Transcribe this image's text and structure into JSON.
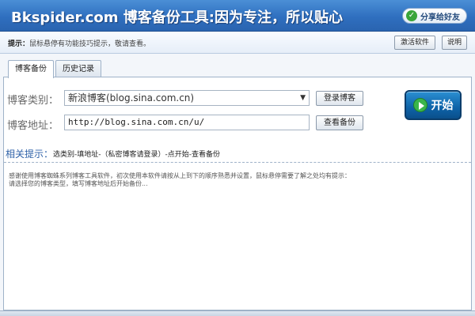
{
  "window": {
    "title": "Bkspider.com 博客备份工具:因为专注，所以贴心"
  },
  "header": {
    "share_label": "分享给好友",
    "share_icon": "share-icon"
  },
  "infobar": {
    "label": "提示：",
    "text": "鼠标悬停有功能技巧提示，敬请查看。",
    "register_label": "激活软件",
    "help_label": "说明"
  },
  "tabs": [
    {
      "label": "博客备份",
      "active": true
    },
    {
      "label": "历史记录",
      "active": false
    }
  ],
  "form": {
    "type_label": "博客类别：",
    "type_value": "新浪博客(blog.sina.com.cn)",
    "login_button": "登录博客",
    "address_label": "博客地址：",
    "address_value": "http://blog.sina.com.cn/u/",
    "view_button": "查看备份",
    "start_button": "开始"
  },
  "hint": {
    "title": "相关提示：",
    "text": "选类别-填地址-（私密博客请登录）-点开始-查看备份"
  },
  "content": {
    "lines": [
      "感谢使用博客蜘蛛系列博客工具软件，初次使用本软件请按从上到下的顺序熟悉并设置，鼠标悬停需要了解之处均有提示：",
      "请选择您的博客类型，填写博客地址后开始备份..."
    ]
  },
  "colors": {
    "title_bar": "#2f6fbf",
    "start_button": "#0e63a8",
    "hint_title": "#2f62a8"
  }
}
